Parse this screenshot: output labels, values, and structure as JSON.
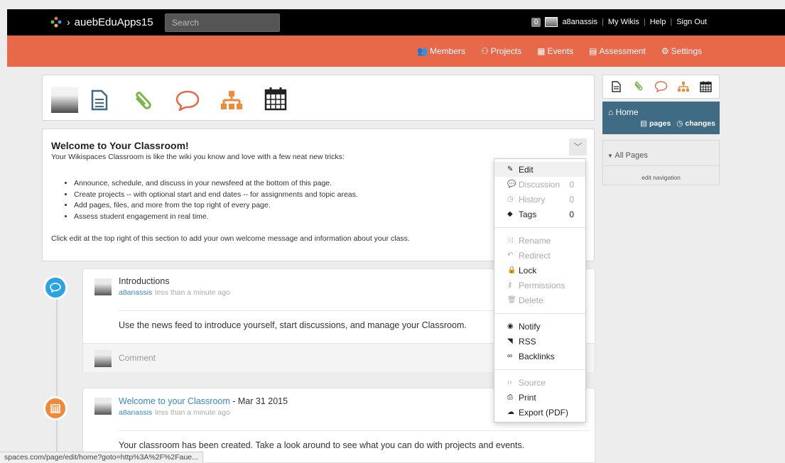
{
  "app": {
    "name": "auebEduApps15"
  },
  "search": {
    "placeholder": "Search"
  },
  "user": {
    "notification_count": "0",
    "username": "a8anassis",
    "links": [
      "My Wikis",
      "Help",
      "Sign Out"
    ]
  },
  "nav": [
    "Members",
    "Projects",
    "Events",
    "Assessment",
    "Settings"
  ],
  "welcome": {
    "title": "Welcome to Your Classroom!",
    "subtitle": "Your Wikispaces Classroom is like the wiki you know and love with a few neat new tricks:",
    "bullets": [
      "Announce, schedule, and discuss in your newsfeed at the bottom of this page.",
      "Create projects -- with optional start and end dates -- for assignments and topic areas.",
      "Add pages, files, and more from the top right of every page.",
      "Assess student engagement in real time."
    ],
    "footer": "Click edit at the top right of this section to add your own welcome message and information about your class."
  },
  "menu": {
    "edit": "Edit",
    "discussion": "Discussion",
    "discussion_count": "0",
    "history": "History",
    "history_count": "0",
    "tags": "Tags",
    "tags_count": "0",
    "rename": "Rename",
    "redirect": "Redirect",
    "lock": "Lock",
    "permissions": "Permissions",
    "delete": "Delete",
    "notify": "Notify",
    "rss": "RSS",
    "backlinks": "Backlinks",
    "source": "Source",
    "print": "Print",
    "export": "Export (PDF)"
  },
  "feed": [
    {
      "title": "Introductions",
      "user": "a8anassis",
      "time": "less than a minute ago",
      "body": "Use the news feed to introduce yourself, start discussions, and manage your Classroom.",
      "comment_placeholder": "Comment"
    },
    {
      "title_link": "Welcome to your Classroom",
      "title_suffix": " - Mar 31 2015",
      "user": "a8anassis",
      "time": "less than a minute ago",
      "body": "Your classroom has been created. Take a look around to see what you can do with projects and events."
    }
  ],
  "sidebar": {
    "home": "Home",
    "pages": "pages",
    "changes": "changes",
    "all_pages": "All Pages",
    "edit_nav": "edit navigation"
  },
  "status_url": "spaces.com/page/edit/home?goto=http%3A%2F%2Faue...",
  "colors": {
    "accent": "#e8684a",
    "topbar": "#000000",
    "home_bg": "#3f6b84",
    "link": "#3a87c8",
    "timeline_blue": "#2aa3e0"
  }
}
